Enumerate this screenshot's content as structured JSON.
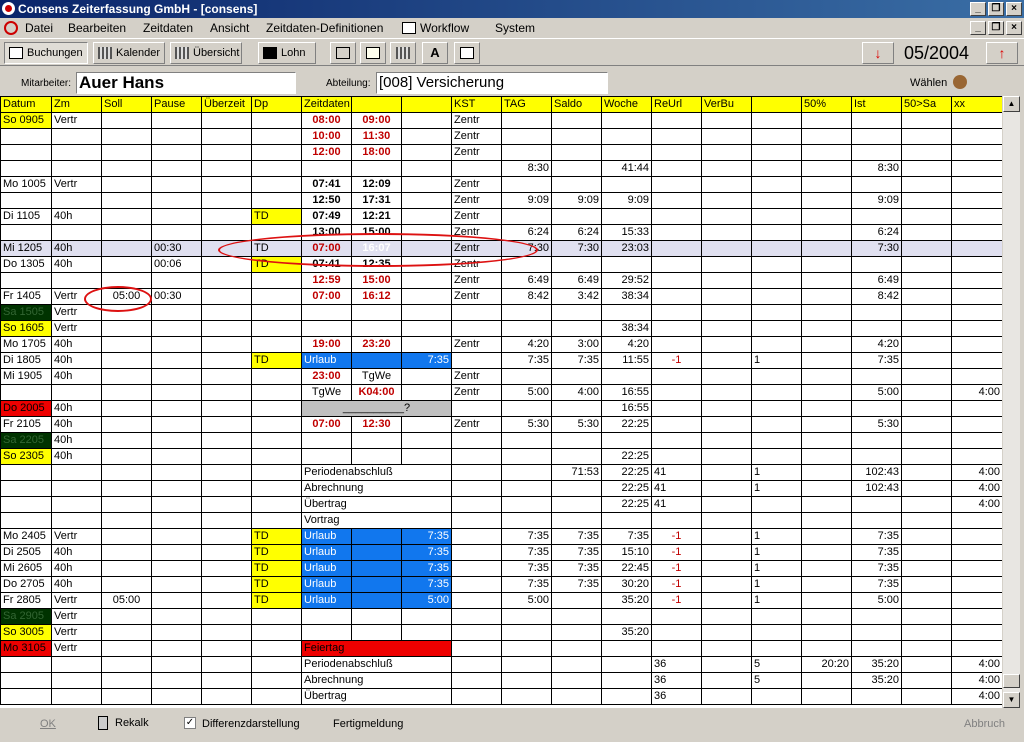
{
  "window": {
    "title": "Consens Zeiterfassung GmbH - [consens]"
  },
  "menu": [
    "Datei",
    "Bearbeiten",
    "Zeitdaten",
    "Ansicht",
    "Zeitdaten-Definitionen",
    "Workflow",
    "System"
  ],
  "toolbar": {
    "buchungen": "Buchungen",
    "kalender": "Kalender",
    "uebersicht": "Übersicht",
    "lohn": "Lohn",
    "month": "05/2004"
  },
  "employee": {
    "label": "Mitarbeiter:",
    "name": "Auer Hans",
    "dept_label": "Abteilung:",
    "dept": "[008] Versicherung",
    "choose": "Wählen"
  },
  "columns": [
    "Datum",
    "Zm",
    "Soll",
    "Pause",
    "Überzeit",
    "Dp",
    "Zeitdaten",
    "",
    "",
    "KST",
    "TAG",
    "Saldo",
    "Woche",
    "ReUrl",
    "VerBu",
    "",
    "50%",
    "Ist",
    "50>Sa",
    "xx"
  ],
  "rows": [
    [
      "So 0905",
      "Vertr",
      "",
      "",
      "",
      "",
      "08:00",
      "09:00",
      "",
      "Zentr",
      "",
      "",
      "",
      "",
      "",
      "",
      "",
      "",
      "",
      ""
    ],
    [
      "",
      "",
      "",
      "",
      "",
      "",
      "10:00",
      "11:30",
      "",
      "Zentr",
      "",
      "",
      "",
      "",
      "",
      "",
      "",
      "",
      "",
      ""
    ],
    [
      "",
      "",
      "",
      "",
      "",
      "",
      "12:00",
      "18:00",
      "",
      "Zentr",
      "",
      "",
      "",
      "",
      "",
      "",
      "",
      "",
      "",
      ""
    ],
    [
      "",
      "",
      "",
      "",
      "",
      "",
      "",
      "",
      "",
      "",
      "8:30",
      "",
      "41:44",
      "",
      "",
      "",
      "",
      "8:30",
      "",
      ""
    ],
    [
      "Mo 1005",
      "Vertr",
      "",
      "",
      "",
      "",
      "07:41",
      "12:09",
      "",
      "Zentr",
      "",
      "",
      "",
      "",
      "",
      "",
      "",
      "",
      "",
      ""
    ],
    [
      "",
      "",
      "",
      "",
      "",
      "",
      "12:50",
      "17:31",
      "",
      "Zentr",
      "9:09",
      "9:09",
      "9:09",
      "",
      "",
      "",
      "",
      "9:09",
      "",
      ""
    ],
    [
      "Di 1105",
      "40h",
      "",
      "",
      "",
      "TD",
      "07:49",
      "12:21",
      "",
      "Zentr",
      "",
      "",
      "",
      "",
      "",
      "",
      "",
      "",
      "",
      ""
    ],
    [
      "",
      "",
      "",
      "",
      "",
      "",
      "13:00",
      "15:00",
      "",
      "Zentr",
      "6:24",
      "6:24",
      "15:33",
      "",
      "",
      "",
      "",
      "6:24",
      "",
      ""
    ],
    [
      "Mi 1205",
      "40h",
      "",
      "00:30",
      "",
      "TD",
      "07:00",
      "16:07",
      "",
      "Zentr",
      "7:30",
      "7:30",
      "23:03",
      "",
      "",
      "",
      "",
      "7:30",
      "",
      ""
    ],
    [
      "Do 1305",
      "40h",
      "",
      "00:06",
      "",
      "TD",
      "07:41",
      "12:35",
      "",
      "Zentr",
      "",
      "",
      "",
      "",
      "",
      "",
      "",
      "",
      "",
      ""
    ],
    [
      "",
      "",
      "",
      "",
      "",
      "",
      "12:59",
      "15:00",
      "",
      "Zentr",
      "6:49",
      "6:49",
      "29:52",
      "",
      "",
      "",
      "",
      "6:49",
      "",
      ""
    ],
    [
      "Fr 1405",
      "Vertr",
      "05:00",
      "00:30",
      "",
      "",
      "07:00",
      "16:12",
      "",
      "Zentr",
      "8:42",
      "3:42",
      "38:34",
      "",
      "",
      "",
      "",
      "8:42",
      "",
      ""
    ],
    [
      "Sa 1505",
      "Vertr",
      "",
      "",
      "",
      "",
      "",
      "",
      "",
      "",
      "",
      "",
      "",
      "",
      "",
      "",
      "",
      "",
      "",
      ""
    ],
    [
      "So 1605",
      "Vertr",
      "",
      "",
      "",
      "",
      "",
      "",
      "",
      "",
      "",
      "",
      "38:34",
      "",
      "",
      "",
      "",
      "",
      "",
      ""
    ],
    [
      "Mo 1705",
      "40h",
      "",
      "",
      "",
      "",
      "19:00",
      "23:20",
      "",
      "Zentr",
      "4:20",
      "3:00",
      "4:20",
      "",
      "",
      "",
      "",
      "4:20",
      "",
      ""
    ],
    [
      "Di 1805",
      "40h",
      "",
      "",
      "",
      "TD",
      "Urlaub",
      "",
      "7:35",
      "",
      "7:35",
      "7:35",
      "11:55",
      "-1",
      "",
      "1",
      "",
      "7:35",
      "",
      ""
    ],
    [
      "Mi 1905",
      "40h",
      "",
      "",
      "",
      "",
      "23:00",
      "TgWe",
      "",
      "Zentr",
      "",
      "",
      "",
      "",
      "",
      "",
      "",
      "",
      "",
      ""
    ],
    [
      "",
      "",
      "",
      "",
      "",
      "",
      "TgWe",
      "K04:00",
      "",
      "Zentr",
      "5:00",
      "4:00",
      "16:55",
      "",
      "",
      "",
      "",
      "5:00",
      "",
      "4:00"
    ],
    [
      "Do 2005",
      "40h",
      "",
      "",
      "",
      "",
      "__________?",
      "",
      "",
      "",
      "",
      "",
      "16:55",
      "",
      "",
      "",
      "",
      "",
      "",
      ""
    ],
    [
      "Fr 2105",
      "40h",
      "",
      "",
      "",
      "",
      "07:00",
      "12:30",
      "",
      "Zentr",
      "5:30",
      "5:30",
      "22:25",
      "",
      "",
      "",
      "",
      "5:30",
      "",
      ""
    ],
    [
      "Sa 2205",
      "40h",
      "",
      "",
      "",
      "",
      "",
      "",
      "",
      "",
      "",
      "",
      "",
      "",
      "",
      "",
      "",
      "",
      "",
      ""
    ],
    [
      "So 2305",
      "40h",
      "",
      "",
      "",
      "",
      "",
      "",
      "",
      "",
      "",
      "",
      "22:25",
      "",
      "",
      "",
      "",
      "",
      "",
      ""
    ],
    [
      "",
      "",
      "",
      "",
      "",
      "",
      "Periodenabschluß",
      "",
      "",
      "",
      "",
      "71:53",
      "22:25",
      "41",
      "",
      "1",
      "",
      "102:43",
      "",
      "4:00"
    ],
    [
      "",
      "",
      "",
      "",
      "",
      "",
      "Abrechnung",
      "",
      "",
      "",
      "",
      "",
      "22:25",
      "41",
      "",
      "1",
      "",
      "102:43",
      "",
      "4:00"
    ],
    [
      "",
      "",
      "",
      "",
      "",
      "",
      "Übertrag",
      "",
      "",
      "",
      "",
      "",
      "22:25",
      "41",
      "",
      "",
      "",
      "",
      "",
      "4:00"
    ],
    [
      "",
      "",
      "",
      "",
      "",
      "",
      "Vortrag",
      "",
      "",
      "",
      "",
      "",
      "",
      "",
      "",
      "",
      "",
      "",
      "",
      ""
    ],
    [
      "Mo 2405",
      "Vertr",
      "",
      "",
      "",
      "TD",
      "Urlaub",
      "",
      "7:35",
      "",
      "7:35",
      "7:35",
      "7:35",
      "-1",
      "",
      "1",
      "",
      "7:35",
      "",
      ""
    ],
    [
      "Di 2505",
      "40h",
      "",
      "",
      "",
      "TD",
      "Urlaub",
      "",
      "7:35",
      "",
      "7:35",
      "7:35",
      "15:10",
      "-1",
      "",
      "1",
      "",
      "7:35",
      "",
      ""
    ],
    [
      "Mi 2605",
      "40h",
      "",
      "",
      "",
      "TD",
      "Urlaub",
      "",
      "7:35",
      "",
      "7:35",
      "7:35",
      "22:45",
      "-1",
      "",
      "1",
      "",
      "7:35",
      "",
      ""
    ],
    [
      "Do 2705",
      "40h",
      "",
      "",
      "",
      "TD",
      "Urlaub",
      "",
      "7:35",
      "",
      "7:35",
      "7:35",
      "30:20",
      "-1",
      "",
      "1",
      "",
      "7:35",
      "",
      ""
    ],
    [
      "Fr 2805",
      "Vertr",
      "05:00",
      "",
      "",
      "TD",
      "Urlaub",
      "",
      "5:00",
      "",
      "5:00",
      "",
      "35:20",
      "-1",
      "",
      "1",
      "",
      "5:00",
      "",
      ""
    ],
    [
      "Sa 2905",
      "Vertr",
      "",
      "",
      "",
      "",
      "",
      "",
      "",
      "",
      "",
      "",
      "",
      "",
      "",
      "",
      "",
      "",
      "",
      ""
    ],
    [
      "So 3005",
      "Vertr",
      "",
      "",
      "",
      "",
      "",
      "",
      "",
      "",
      "",
      "",
      "35:20",
      "",
      "",
      "",
      "",
      "",
      "",
      ""
    ],
    [
      "Mo 3105",
      "Vertr",
      "",
      "",
      "",
      "",
      "Feiertag",
      "",
      "",
      "",
      "",
      "",
      "",
      "",
      "",
      "",
      "",
      "",
      "",
      ""
    ],
    [
      "",
      "",
      "",
      "",
      "",
      "",
      "Periodenabschluß",
      "",
      "",
      "",
      "",
      "",
      "",
      "36",
      "",
      "5",
      "20:20",
      "35:20",
      "",
      "4:00"
    ],
    [
      "",
      "",
      "",
      "",
      "",
      "",
      "Abrechnung",
      "",
      "",
      "",
      "",
      "",
      "",
      "36",
      "",
      "5",
      "",
      "35:20",
      "",
      "4:00"
    ],
    [
      "",
      "",
      "",
      "",
      "",
      "",
      "Übertrag",
      "",
      "",
      "",
      "",
      "",
      "",
      "36",
      "",
      "",
      "",
      "",
      "",
      "4:00"
    ]
  ],
  "status": {
    "ok": "OK",
    "rekalk": "Rekalk",
    "diff": "Differenzdarstellung",
    "fertig": "Fertigmeldung",
    "abbruch": "Abbruch"
  }
}
